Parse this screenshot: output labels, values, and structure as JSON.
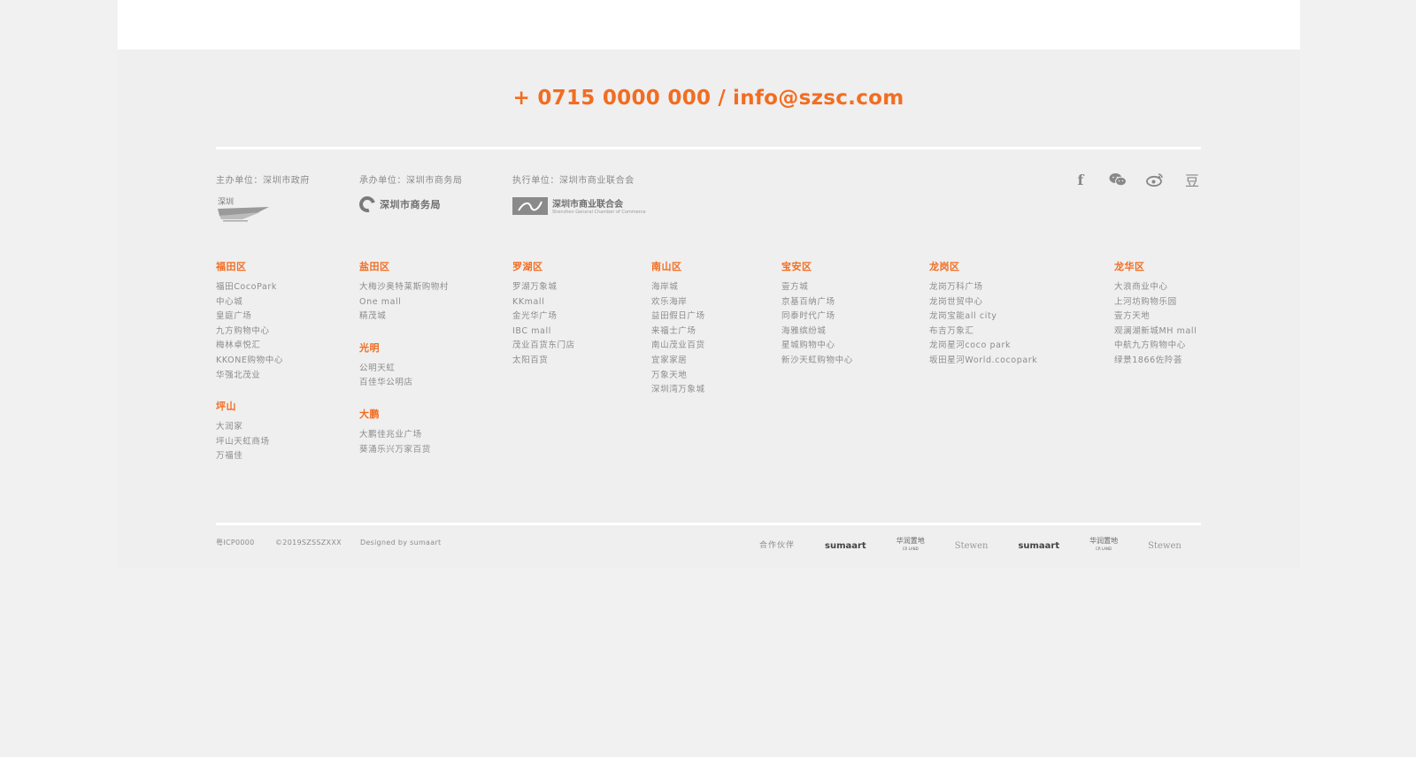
{
  "contact": {
    "phone": "+ 0715 0000 000",
    "separator": "/",
    "email": "info@szsc.com"
  },
  "orgs": [
    {
      "label": "主办单位：深圳市政府",
      "logo": "深圳"
    },
    {
      "label": "承办单位：深圳市商务局",
      "logo": "深圳市商务局"
    },
    {
      "label": "执行单位：深圳市商业联合会",
      "logo": "深圳市商业联合会",
      "logo_sub": "Shenzhen General Chamber of Commerce"
    }
  ],
  "social": [
    "facebook-icon",
    "wechat-icon",
    "weibo-icon",
    "douban-icon"
  ],
  "social_glyphs": {
    "douban": "豆",
    "facebook": "f"
  },
  "districts": [
    {
      "groups": [
        {
          "title": "福田区",
          "items": [
            "福田CocoPark",
            "中心城",
            "皇庭广场",
            "九方购物中心",
            "梅林卓悦汇",
            "KKONE购物中心",
            "华强北茂业"
          ]
        },
        {
          "title": "坪山",
          "items": [
            "大润家",
            "坪山天虹商场",
            "万福佳"
          ]
        }
      ]
    },
    {
      "groups": [
        {
          "title": "盐田区",
          "items": [
            "大梅沙奥特莱斯购物村",
            "One mall",
            "精茂城"
          ]
        },
        {
          "title": "光明",
          "items": [
            "公明天虹",
            "百佳华公明店"
          ]
        },
        {
          "title": "大鹏",
          "items": [
            "大鹏佳兆业广场",
            "葵涌乐兴万家百货"
          ]
        }
      ]
    },
    {
      "groups": [
        {
          "title": "罗湖区",
          "items": [
            "罗湖万象城",
            "KKmall",
            "金光华广场",
            "IBC mall",
            "茂业百货东门店",
            "太阳百货"
          ]
        }
      ]
    },
    {
      "groups": [
        {
          "title": "南山区",
          "items": [
            "海岸城",
            "欢乐海岸",
            "益田假日广场",
            "来福士广场",
            "南山茂业百货",
            "宜家家居",
            "万象天地",
            "深圳湾万象城"
          ]
        }
      ]
    },
    {
      "groups": [
        {
          "title": "宝安区",
          "items": [
            "壹方城",
            "京基百纳广场",
            "同泰时代广场",
            "海雅缤纷城",
            "星城购物中心",
            "新沙天虹购物中心"
          ]
        }
      ]
    },
    {
      "groups": [
        {
          "title": "龙岗区",
          "items": [
            "龙岗万科广场",
            "龙岗世贸中心",
            "龙岗宝能all city",
            "布吉万象汇",
            "龙岗星河coco park",
            "坂田星河World.cocopark"
          ]
        }
      ]
    },
    {
      "groups": [
        {
          "title": "龙华区",
          "items": [
            "大浪商业中心",
            "上河坊购物乐园",
            "壹方天地",
            "观澜湖新城MH mall",
            "中航九方购物中心",
            "绿景1866佐阾荟"
          ]
        }
      ]
    }
  ],
  "bottom": {
    "icp": "粤ICP0000",
    "copyright": "©2019SZSSZXXX",
    "designed": "Designed by sumaart",
    "partners_label": "合作伙伴",
    "partners": [
      {
        "type": "sumaart",
        "text": "sumaart"
      },
      {
        "type": "cr",
        "text": "华润置地",
        "sub": "CR LAND"
      },
      {
        "type": "sw",
        "text": "Stewen"
      },
      {
        "type": "sumaart",
        "text": "sumaart"
      },
      {
        "type": "cr",
        "text": "华润置地",
        "sub": "CR LAND"
      },
      {
        "type": "sw",
        "text": "Stewen"
      }
    ]
  },
  "colors": {
    "accent": "#f26d21",
    "background": "#efefef",
    "text": "#8c8c8c"
  }
}
